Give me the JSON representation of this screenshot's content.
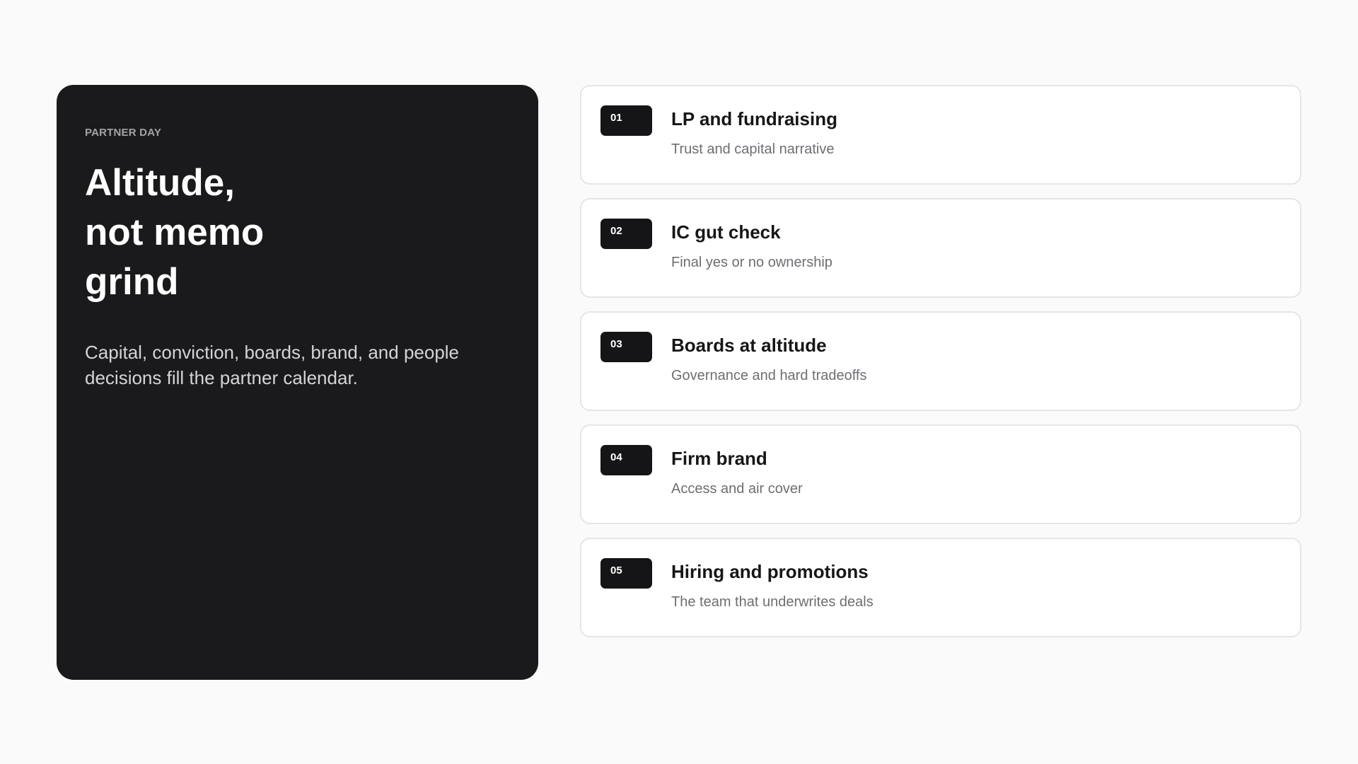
{
  "hero": {
    "eyebrow": "PARTNER DAY",
    "headline_lines": [
      "Altitude,",
      "not memo",
      "grind"
    ],
    "lede": "Capital, conviction, boards, brand, and people decisions fill the partner calendar."
  },
  "agenda": {
    "items": [
      {
        "number": "01",
        "title": "LP and fundraising",
        "subtitle": "Trust and capital narrative"
      },
      {
        "number": "02",
        "title": "IC gut check",
        "subtitle": "Final yes or no ownership"
      },
      {
        "number": "03",
        "title": "Boards at altitude",
        "subtitle": "Governance and hard tradeoffs"
      },
      {
        "number": "04",
        "title": "Firm brand",
        "subtitle": "Access and air cover"
      },
      {
        "number": "05",
        "title": "Hiring and promotions",
        "subtitle": "The team that underwrites deals"
      }
    ]
  },
  "colors": {
    "page_background": "#fafafa",
    "hero_background": "#1a1a1c",
    "badge_background": "#151517",
    "card_border": "#e6e6e8"
  }
}
